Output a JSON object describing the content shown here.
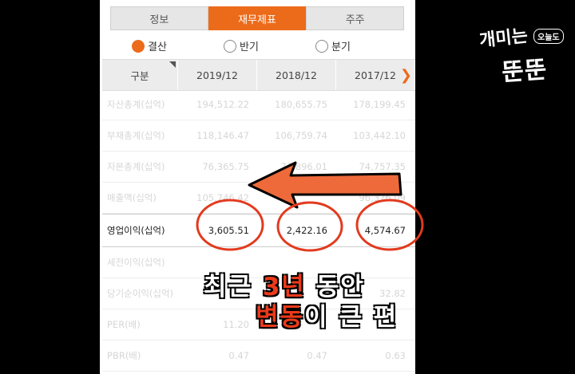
{
  "tabs": [
    {
      "label": "정보"
    },
    {
      "label": "재무제표"
    },
    {
      "label": "주주"
    }
  ],
  "radios": [
    {
      "label": "결산"
    },
    {
      "label": "반기"
    },
    {
      "label": "분기"
    }
  ],
  "table": {
    "header": {
      "col0": "구분",
      "years": [
        "2019/12",
        "2018/12",
        "2017/12"
      ]
    },
    "rows": [
      {
        "label": "자산총계(십억)",
        "values": [
          "194,512.22",
          "180,655.75",
          "178,199.45"
        ]
      },
      {
        "label": "부채총계(십억)",
        "values": [
          "118,146.47",
          "106,759.74",
          "103,442.10"
        ]
      },
      {
        "label": "자본총계(십억)",
        "values": [
          "76,365.75",
          "73,896.01",
          "74,757.35"
        ]
      },
      {
        "label": "매출액(십억)",
        "values": [
          "105,746.42",
          "",
          "96,376.09"
        ]
      },
      {
        "label": "영업이익(십억)",
        "values": [
          "3,605.51",
          "2,422.16",
          "4,574.67"
        ]
      },
      {
        "label": "세전이익(십억)",
        "values": [
          "",
          "",
          ""
        ]
      },
      {
        "label": "당기순이익(십억)",
        "values": [
          "",
          "",
          "32.82"
        ]
      },
      {
        "label": "PER(배)",
        "values": [
          "11.20",
          "",
          ""
        ]
      },
      {
        "label": "PBR(배)",
        "values": [
          "0.47",
          "0.47",
          "0.63"
        ]
      }
    ]
  },
  "caption": {
    "line1_a": "최근 ",
    "line1_b": "3년",
    "line1_c": " 동안",
    "line2_a": "변동",
    "line2_b": "이 큰 편"
  },
  "logo": {
    "line1": "개미는",
    "badge": "오늘도",
    "line2": "뚠뚠"
  },
  "colors": {
    "accent": "#ec6b1a",
    "circle": "#e23a1e"
  }
}
